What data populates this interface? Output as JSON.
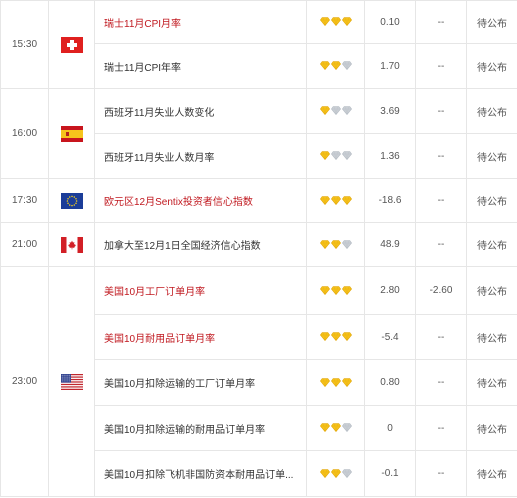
{
  "colors": {
    "important_text": "#c0181f",
    "normal_text": "#333333",
    "star_on": "#f6c21a",
    "star_off": "#c9ced4",
    "border": "#e6e6e6"
  },
  "groups": [
    {
      "time": "15:30",
      "flag_icon": "switzerland-flag-icon",
      "events": [
        {
          "name": "瑞士11月CPI月率",
          "important": true,
          "stars": 3,
          "previous": "0.10",
          "forecast": "--",
          "actual": "待公布"
        },
        {
          "name": "瑞士11月CPI年率",
          "important": false,
          "stars": 2,
          "previous": "1.70",
          "forecast": "--",
          "actual": "待公布"
        }
      ]
    },
    {
      "time": "16:00",
      "flag_icon": "spain-flag-icon",
      "events": [
        {
          "name": "西班牙11月失业人数变化",
          "important": false,
          "stars": 1,
          "previous": "3.69",
          "forecast": "--",
          "actual": "待公布"
        },
        {
          "name": "西班牙11月失业人数月率",
          "important": false,
          "stars": 1,
          "previous": "1.36",
          "forecast": "--",
          "actual": "待公布"
        }
      ]
    },
    {
      "time": "17:30",
      "flag_icon": "eurozone-flag-icon",
      "events": [
        {
          "name": "欧元区12月Sentix投资者信心指数",
          "important": true,
          "stars": 3,
          "previous": "-18.6",
          "forecast": "--",
          "actual": "待公布"
        }
      ]
    },
    {
      "time": "21:00",
      "flag_icon": "canada-flag-icon",
      "events": [
        {
          "name": "加拿大至12月1日全国经济信心指数",
          "important": false,
          "stars": 2,
          "previous": "48.9",
          "forecast": "--",
          "actual": "待公布"
        }
      ]
    },
    {
      "time": "23:00",
      "flag_icon": "usa-flag-icon",
      "events": [
        {
          "name": "美国10月工厂订单月率",
          "important": true,
          "stars": 3,
          "previous": "2.80",
          "forecast": "-2.60",
          "actual": "待公布"
        },
        {
          "name": "美国10月耐用品订单月率",
          "important": true,
          "stars": 3,
          "previous": "-5.4",
          "forecast": "--",
          "actual": "待公布"
        },
        {
          "name": "美国10月扣除运输的工厂订单月率",
          "important": false,
          "stars": 3,
          "previous": "0.80",
          "forecast": "--",
          "actual": "待公布"
        },
        {
          "name": "美国10月扣除运输的耐用品订单月率",
          "important": false,
          "stars": 2,
          "previous": "0",
          "forecast": "--",
          "actual": "待公布"
        },
        {
          "name": "美国10月扣除飞机非国防资本耐用品订单...",
          "important": false,
          "stars": 2,
          "previous": "-0.1",
          "forecast": "--",
          "actual": "待公布"
        }
      ]
    }
  ]
}
